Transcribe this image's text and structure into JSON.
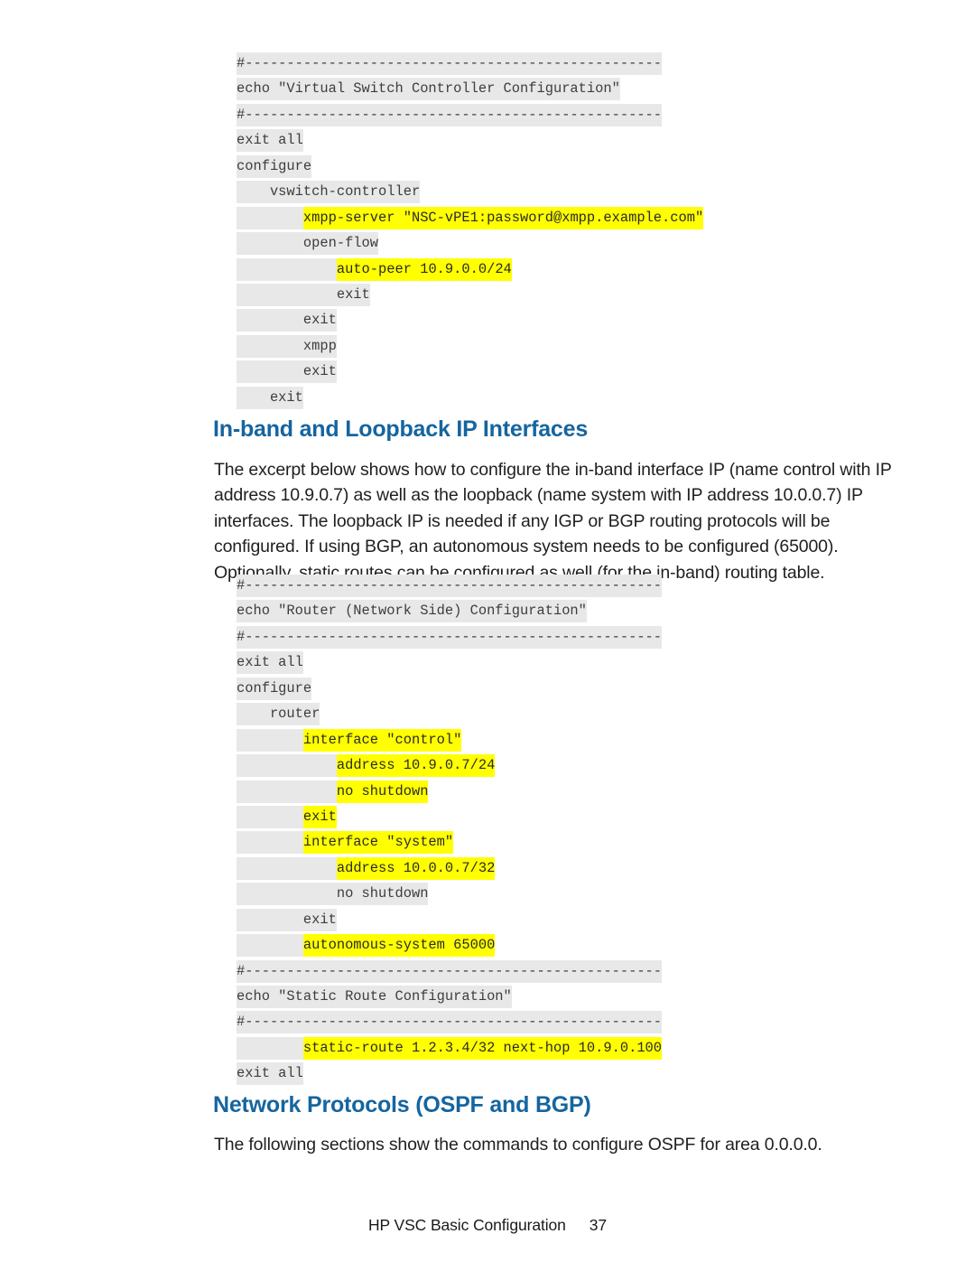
{
  "document": {
    "footer": {
      "title": "HP VSC Basic Configuration",
      "page_number": "37"
    }
  },
  "code_block_1": {
    "name": "virtual-switch-controller-configuration",
    "lines": [
      {
        "indent": "",
        "text": "#--------------------------------------------------",
        "highlight": false
      },
      {
        "indent": "",
        "text": "echo \"Virtual Switch Controller Configuration\"",
        "highlight": false
      },
      {
        "indent": "",
        "text": "#--------------------------------------------------",
        "highlight": false
      },
      {
        "indent": "",
        "text": "exit all",
        "highlight": false
      },
      {
        "indent": "",
        "text": "configure",
        "highlight": false
      },
      {
        "indent": "    ",
        "text": "vswitch-controller",
        "highlight": false
      },
      {
        "indent": "        ",
        "text": "xmpp-server \"NSC-vPE1:password@xmpp.example.com\"",
        "highlight": true
      },
      {
        "indent": "        ",
        "text": "open-flow",
        "highlight": false
      },
      {
        "indent": "            ",
        "text": "auto-peer 10.9.0.0/24",
        "highlight": true
      },
      {
        "indent": "            ",
        "text": "exit",
        "highlight": false
      },
      {
        "indent": "        ",
        "text": "exit",
        "highlight": false
      },
      {
        "indent": "        ",
        "text": "xmpp",
        "highlight": false
      },
      {
        "indent": "        ",
        "text": "exit",
        "highlight": false
      },
      {
        "indent": "    ",
        "text": "exit",
        "highlight": false
      }
    ]
  },
  "section_inband": {
    "heading": "In-band and Loopback IP Interfaces",
    "paragraph": "The excerpt below shows how to configure the in-band interface IP (name control with IP address 10.9.0.7) as well as the loopback (name system with IP address 10.0.0.7) IP interfaces. The loopback IP is needed if any IGP or BGP routing protocols will be configured. If using BGP, an autonomous system needs to be configured (65000). Optionally, static routes can be configured as well (for the in-band) routing table."
  },
  "code_block_2": {
    "name": "router-network-side-configuration",
    "lines": [
      {
        "indent": "",
        "text": "#--------------------------------------------------",
        "highlight": false
      },
      {
        "indent": "",
        "text": "echo \"Router (Network Side) Configuration\"",
        "highlight": false
      },
      {
        "indent": "",
        "text": "#--------------------------------------------------",
        "highlight": false
      },
      {
        "indent": "",
        "text": "exit all",
        "highlight": false
      },
      {
        "indent": "",
        "text": "configure",
        "highlight": false
      },
      {
        "indent": "    ",
        "text": "router",
        "highlight": false
      },
      {
        "indent": "        ",
        "text": "interface \"control\"",
        "highlight": true
      },
      {
        "indent": "            ",
        "text": "address 10.9.0.7/24",
        "highlight": true
      },
      {
        "indent": "            ",
        "text": "no shutdown",
        "highlight": true
      },
      {
        "indent": "        ",
        "text": "exit",
        "highlight": true
      },
      {
        "indent": "        ",
        "text": "interface \"system\"",
        "highlight": true
      },
      {
        "indent": "            ",
        "text": "address 10.0.0.7/32",
        "highlight": true
      },
      {
        "indent": "            ",
        "text": "no shutdown",
        "highlight": false
      },
      {
        "indent": "        ",
        "text": "exit",
        "highlight": false
      },
      {
        "indent": "        ",
        "text": "autonomous-system 65000",
        "highlight": true
      },
      {
        "indent": "",
        "text": "#--------------------------------------------------",
        "highlight": false
      },
      {
        "indent": "",
        "text": "echo \"Static Route Configuration\"",
        "highlight": false
      },
      {
        "indent": "",
        "text": "#--------------------------------------------------",
        "highlight": false
      },
      {
        "indent": "        ",
        "text": "static-route 1.2.3.4/32 next-hop 10.9.0.100",
        "highlight": true
      },
      {
        "indent": "",
        "text": "exit all",
        "highlight": false
      }
    ]
  },
  "section_protocols": {
    "heading": "Network Protocols (OSPF and BGP)",
    "paragraph": "The following sections show the commands to configure OSPF for area 0.0.0.0."
  }
}
